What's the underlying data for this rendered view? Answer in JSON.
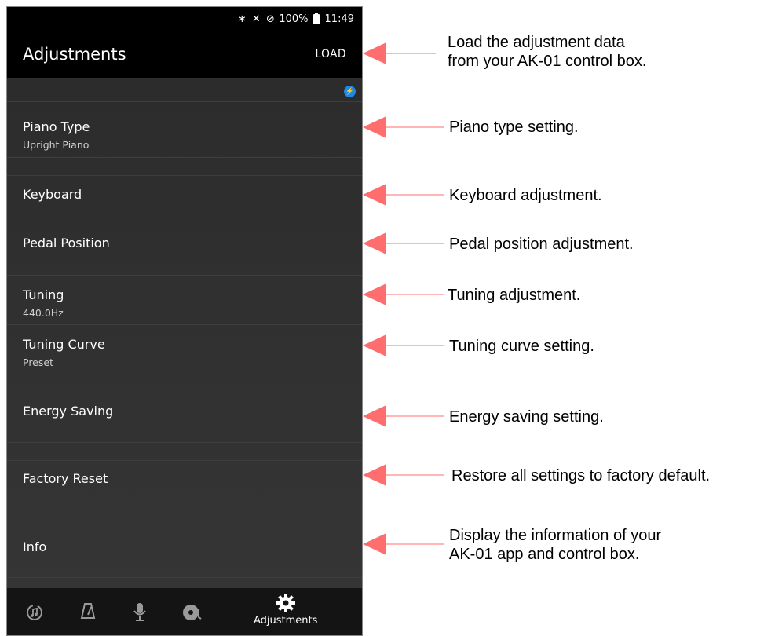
{
  "status_bar": {
    "battery": "100%",
    "time": "11:49"
  },
  "app_bar": {
    "title": "Adjustments",
    "load_label": "LOAD"
  },
  "settings": [
    {
      "title": "Piano Type",
      "subtitle": "Upright Piano"
    },
    {
      "title": "Keyboard"
    },
    {
      "title": "Pedal Position"
    },
    {
      "title": "Tuning",
      "subtitle": "440.0Hz"
    },
    {
      "title": "Tuning Curve",
      "subtitle": "Preset"
    },
    {
      "title": "Energy Saving"
    },
    {
      "title": "Factory Reset"
    },
    {
      "title": "Info"
    }
  ],
  "bottom_nav": {
    "items": [
      {
        "icon": "music-sync-icon"
      },
      {
        "icon": "metronome-icon"
      },
      {
        "icon": "microphone-icon"
      },
      {
        "icon": "record-icon"
      },
      {
        "icon": "gear-icon",
        "label": "Adjustments"
      }
    ]
  },
  "annotations": {
    "load": [
      "Load the adjustment data",
      "from your AK-01 control box."
    ],
    "piano_type": "Piano type setting.",
    "keyboard": "Keyboard adjustment.",
    "pedal": "Pedal position adjustment.",
    "tuning": "Tuning adjustment.",
    "tuning_curve": "Tuning curve setting.",
    "energy": "Energy saving setting.",
    "factory": "Restore all settings to factory default.",
    "info": [
      "Display the information of your",
      "AK-01 app and control box."
    ]
  },
  "colors": {
    "arrow": "#ff6e6e",
    "accent": "#1e88e5"
  }
}
